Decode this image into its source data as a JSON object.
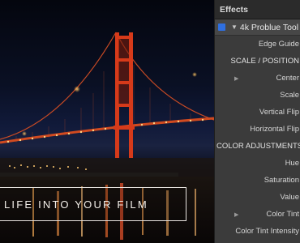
{
  "viewer": {
    "overlay_title": "LIFE INTO YOUR FILM"
  },
  "panel": {
    "title": "Effects",
    "effect": {
      "name": "4k Problue Tool",
      "enabled": true,
      "checkbox_color": "#2f6fe0"
    },
    "params": [
      {
        "label": "Edge Guide",
        "type": "param"
      },
      {
        "label": "SCALE / POSITION",
        "type": "section"
      },
      {
        "label": "Center",
        "type": "param",
        "disclosure": true
      },
      {
        "label": "Scale",
        "type": "param"
      },
      {
        "label": "Vertical Flip",
        "type": "param"
      },
      {
        "label": "Horizontal Flip",
        "type": "param"
      },
      {
        "label": "COLOR ADJUSTMENTS",
        "type": "section"
      },
      {
        "label": "Hue",
        "type": "param"
      },
      {
        "label": "Saturation",
        "type": "param"
      },
      {
        "label": "Value",
        "type": "param"
      },
      {
        "label": "Color Tint",
        "type": "param",
        "disclosure": true
      },
      {
        "label": "Color Tint Intensity",
        "type": "param"
      }
    ]
  },
  "colors": {
    "bridge": "#d63a1a",
    "panel_bg": "#3b3b3b",
    "accent": "#2f6fe0"
  }
}
